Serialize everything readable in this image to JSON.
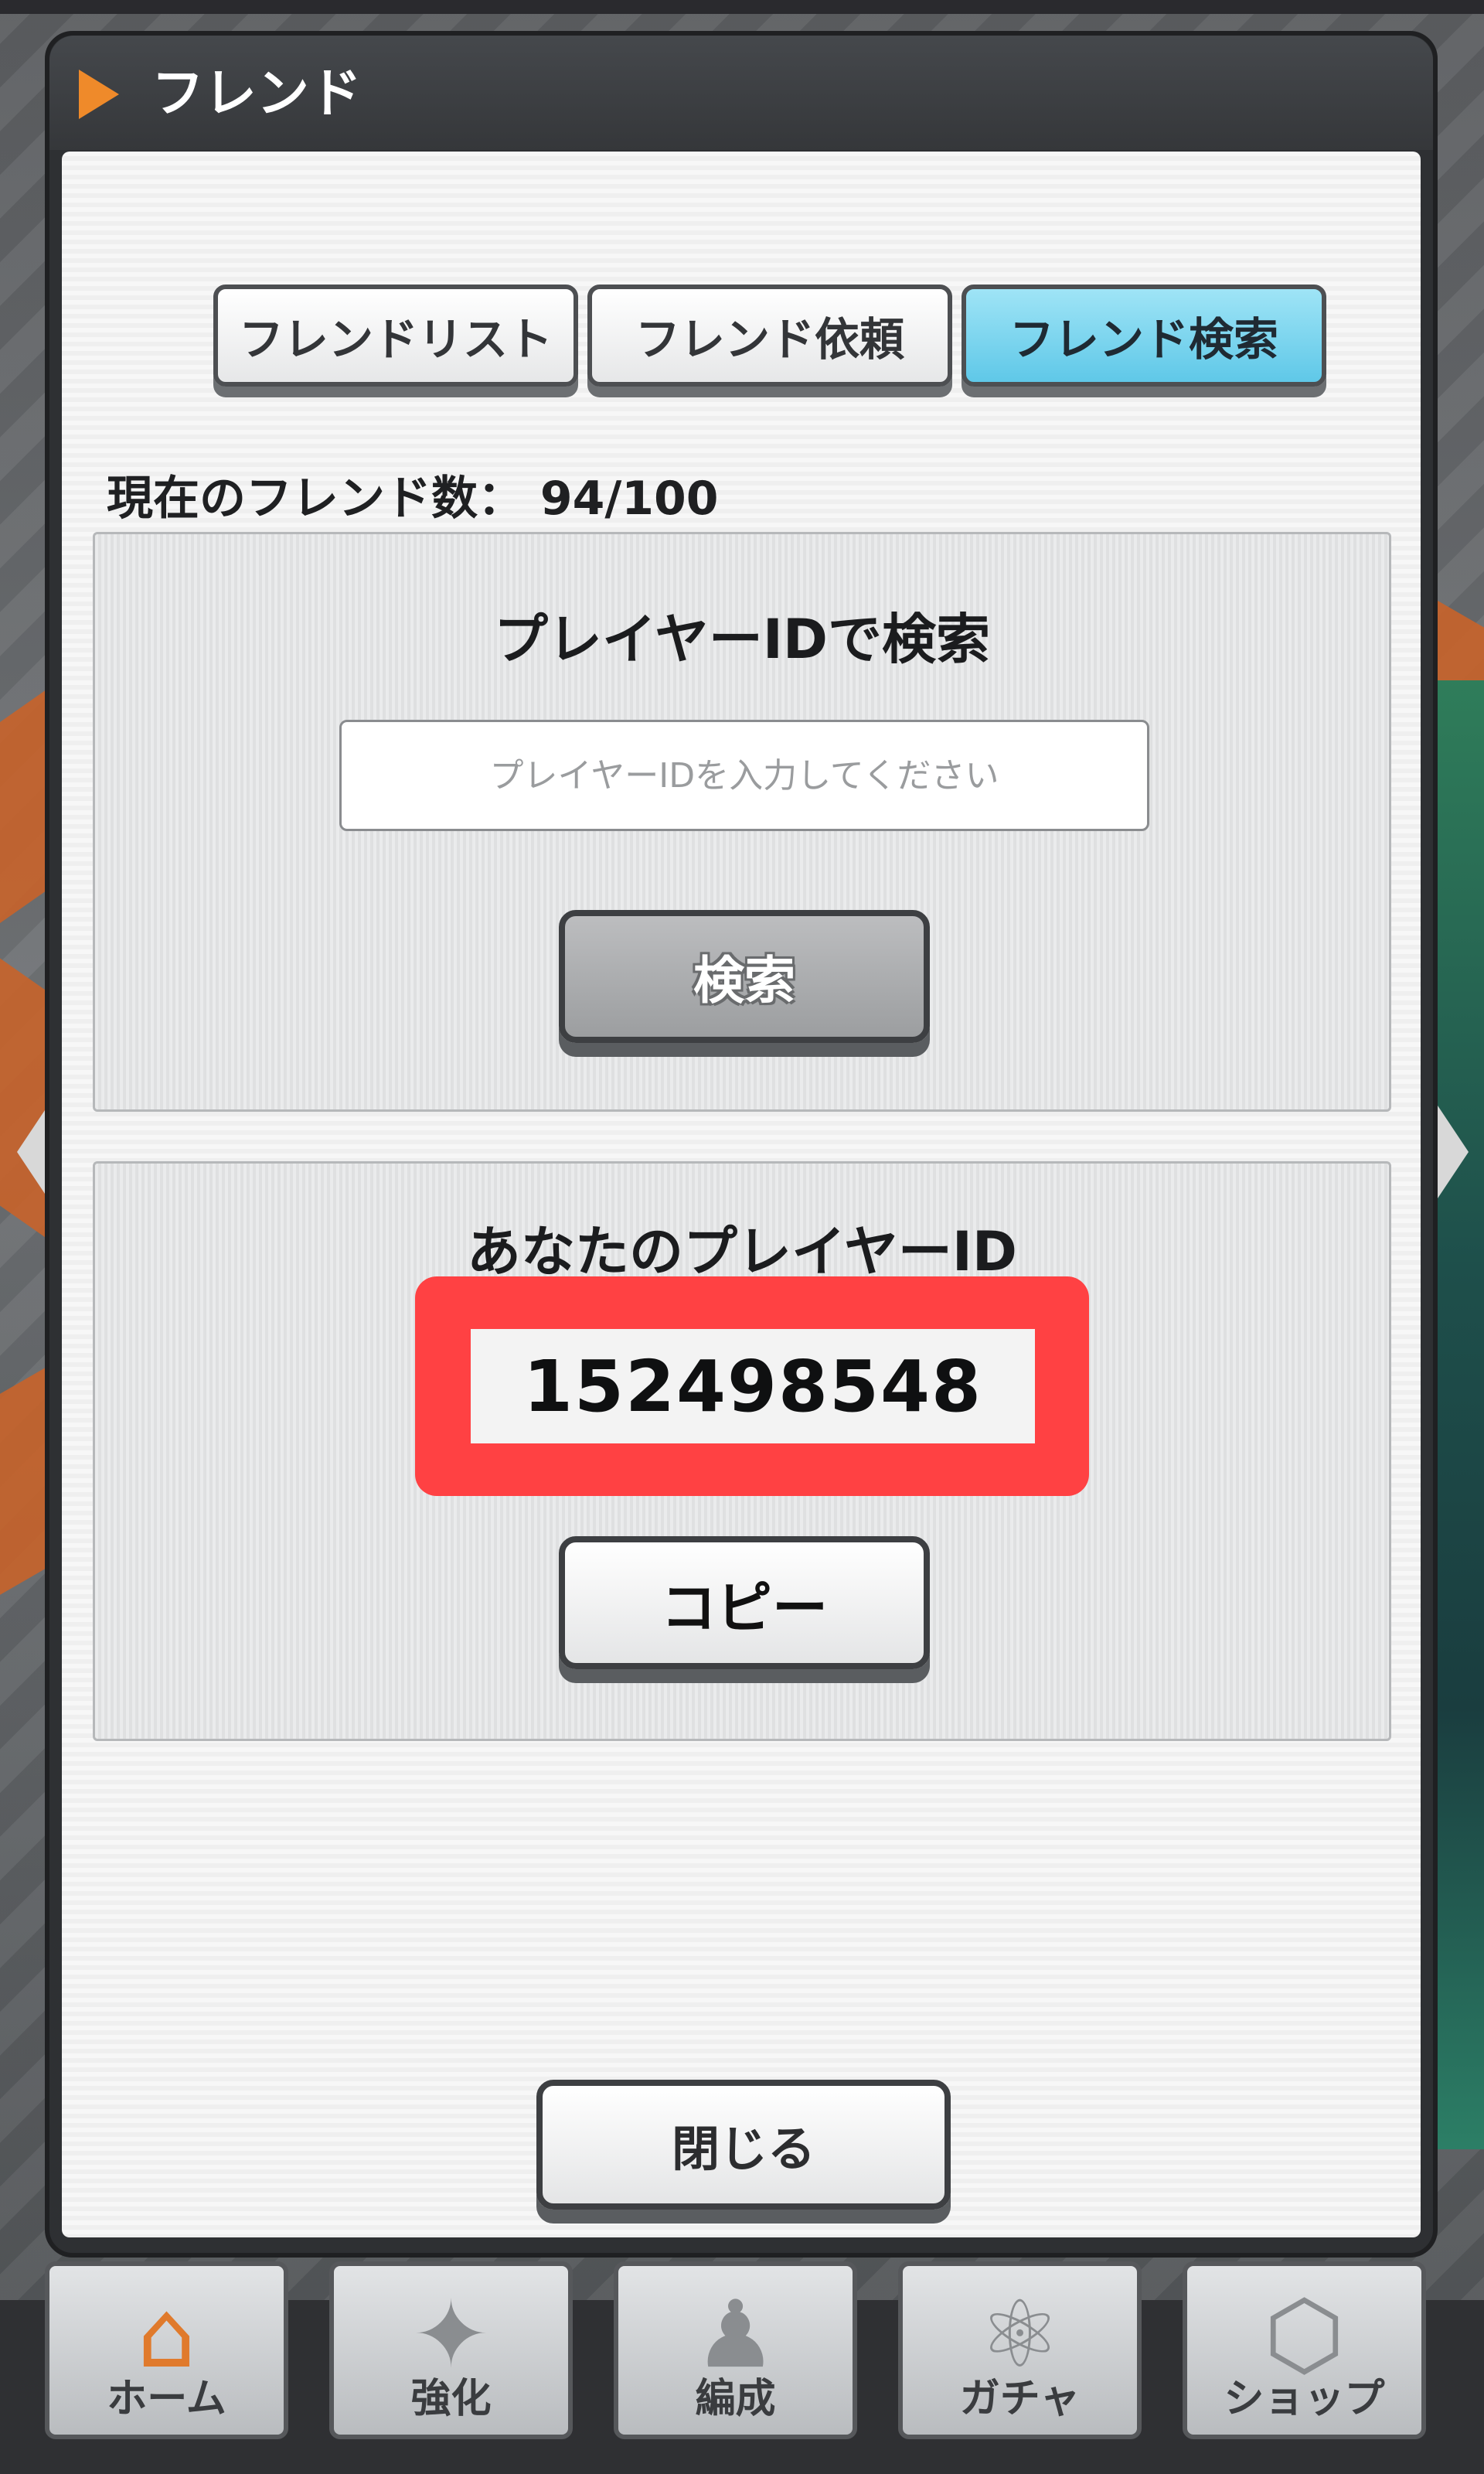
{
  "dialog": {
    "title": "フレンド"
  },
  "tabs": [
    {
      "label": "フレンドリスト",
      "active": false
    },
    {
      "label": "フレンド依頼",
      "active": false
    },
    {
      "label": "フレンド検索",
      "active": true
    }
  ],
  "friend_count": {
    "text": "現在のフレンド数：  94/100",
    "current": 94,
    "max": 100
  },
  "search": {
    "heading": "プレイヤーIDで検索",
    "placeholder": "プレイヤーIDを入力してください",
    "value": "",
    "button_label": "検索"
  },
  "my_id": {
    "heading": "あなたのプレイヤーID",
    "player_id": "152498548",
    "copy_label": "コピー"
  },
  "close_label": "閉じる",
  "bottom_nav": [
    {
      "label": "ホーム",
      "icon": "home-icon",
      "active": true
    },
    {
      "label": "強化",
      "icon": "dumbbell-icon",
      "active": false
    },
    {
      "label": "編成",
      "icon": "team-icon",
      "active": false
    },
    {
      "label": "ガチャ",
      "icon": "gacha-icon",
      "active": false
    },
    {
      "label": "ショップ",
      "icon": "shop-icon",
      "active": false
    }
  ],
  "colors": {
    "accent_tab": "#5fc8e8",
    "highlight": "#ff4143",
    "header_arrow": "#ef8a2a"
  }
}
